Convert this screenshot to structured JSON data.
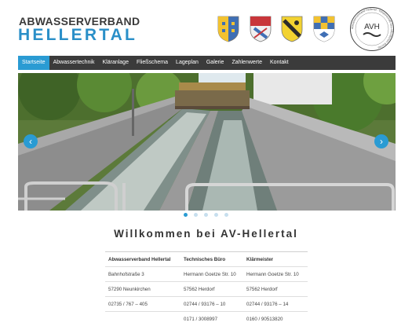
{
  "brand": {
    "line1": "ABWASSERVERBAND",
    "line2": "HELLERTAL"
  },
  "crests": [
    {
      "name": "crest-1",
      "colors": [
        "#f2c230",
        "#3f6fb5"
      ]
    },
    {
      "name": "crest-2",
      "colors": [
        "#c8363a",
        "#f0f0f0",
        "#3f6fb5"
      ]
    },
    {
      "name": "crest-3",
      "colors": [
        "#f2d230",
        "#2b2b2b"
      ]
    },
    {
      "name": "crest-4",
      "colors": [
        "#f2c230",
        "#3f6fb5",
        "#ffffff"
      ]
    }
  ],
  "seal": {
    "text_center": "AVH",
    "text_ring": "Abwasserverband Hellertal · Körperschaft des öffentlichen Rechts"
  },
  "nav": {
    "items": [
      {
        "label": "Startseite",
        "active": true
      },
      {
        "label": "Abwassertechnik",
        "active": false
      },
      {
        "label": "Kläranlage",
        "active": false
      },
      {
        "label": "Fließschema",
        "active": false
      },
      {
        "label": "Lageplan",
        "active": false
      },
      {
        "label": "Galerie",
        "active": false
      },
      {
        "label": "Zahlenwerte",
        "active": false
      },
      {
        "label": "Kontakt",
        "active": false
      }
    ]
  },
  "slider": {
    "prev_icon": "chevron-left-icon",
    "next_icon": "chevron-right-icon",
    "dots": 5,
    "active_dot": 0
  },
  "main": {
    "title": "Willkommen bei AV-Hellertal"
  },
  "contacts": {
    "headers": [
      "Abwasserverband Hellertal",
      "Technisches Büro",
      "Klärmeister"
    ],
    "rows": [
      [
        "Bahnhofstraße 3",
        "Hermann Goetze Str. 10",
        "Hermann Goetze Str. 10"
      ],
      [
        "57290 Neunkirchen",
        "57562 Herdorf",
        "57562 Herdorf"
      ],
      [
        "02735 / 767 – 405",
        "02744 / 93176 – 10",
        "02744 / 93176 – 14"
      ],
      [
        "",
        "0171 / 3008997",
        "0160 / 90513820"
      ]
    ]
  },
  "colors": {
    "accent": "#2a9bd3",
    "nav_bg": "#3b3b3b",
    "brand_blue": "#2a8fc8"
  }
}
